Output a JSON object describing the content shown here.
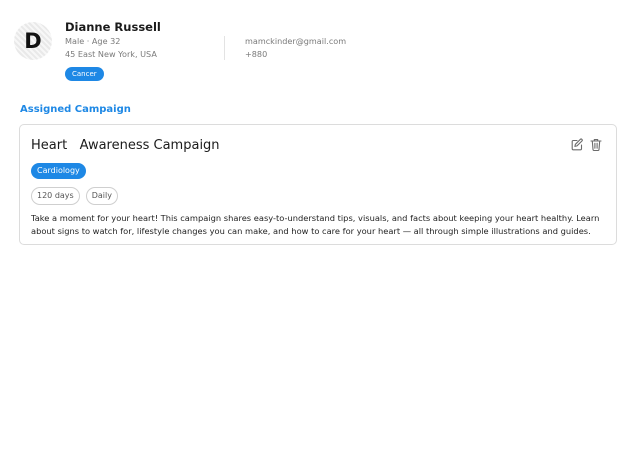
{
  "patient": {
    "avatar_initial": "D",
    "name": "Dianne Russell",
    "demographics": "Male · Age 32",
    "address": "45 East New York, USA",
    "condition_tag": "Cancer",
    "email": "mamckinder@gmail.com",
    "phone": "+880"
  },
  "section": {
    "title": "Assigned Campaign"
  },
  "campaign": {
    "title": "Heart   Awareness Campaign",
    "category": "Cardiology",
    "duration": "120 days",
    "frequency": "Daily",
    "description": "Take a moment for your heart! This campaign shares easy-to-understand tips, visuals, and facts about keeping your heart healthy. Learn about signs to watch for, lifestyle changes you can make, and how to care for your heart — all through simple illustrations and guides.",
    "icons": {
      "edit": "edit-icon",
      "delete": "trash-icon"
    }
  },
  "colors": {
    "accent": "#1e88e5",
    "text": "#1b1b1b",
    "muted": "#7a7a7a",
    "border": "#dcdcdc"
  }
}
